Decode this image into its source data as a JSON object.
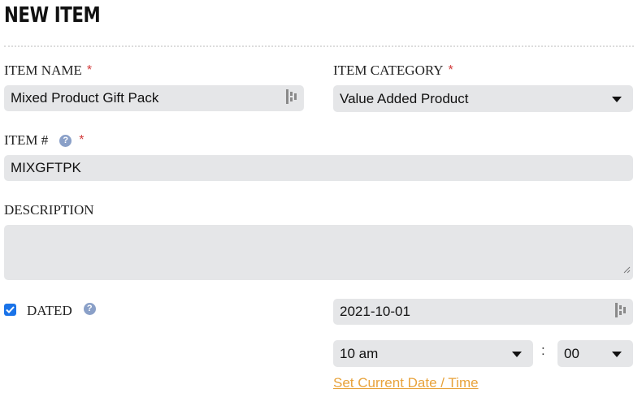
{
  "page": {
    "title": "NEW ITEM"
  },
  "colors": {
    "required": "#d23a3a",
    "field_bg": "#e5e6e8",
    "link": "#e8a33c",
    "checkbox": "#1a73e8",
    "help": "#8aa0c8"
  },
  "form": {
    "item_name": {
      "label": "ITEM NAME",
      "required_mark": "*",
      "value": "Mixed Product Gift Pack"
    },
    "item_category": {
      "label": "ITEM CATEGORY",
      "required_mark": "*",
      "value": "Value Added Product"
    },
    "item_number": {
      "label": "ITEM #",
      "help": "?",
      "required_mark": "*",
      "value": "MIXGFTPK"
    },
    "description": {
      "label": "DESCRIPTION",
      "value": ""
    },
    "dated": {
      "label": "DATED",
      "help": "?",
      "checked": true,
      "date_value": "2021-10-01",
      "hour_value": "10 am",
      "separator": ":",
      "minute_value": "00",
      "set_current_link": "Set Current Date / Time"
    }
  }
}
